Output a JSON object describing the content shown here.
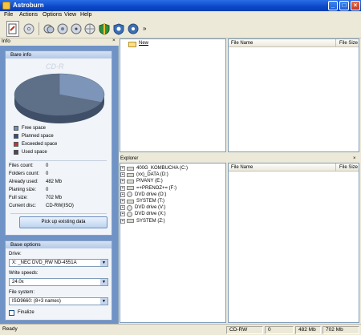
{
  "window": {
    "title": "Astroburn"
  },
  "menu": [
    "File",
    "Actions",
    "Options",
    "View",
    "Help"
  ],
  "toolbar": {
    "icons": [
      "new-project-icon",
      "burn-disc-icon",
      "copy-disc-icon",
      "erase-disc-icon",
      "disc-info-icon",
      "settings-icon",
      "shield-icon",
      "disc-image-icon",
      "help-icon"
    ],
    "expand_glyph": "»"
  },
  "info": {
    "header": "Info",
    "close_glyph": "×",
    "bare_info_title": "Bare info",
    "watermark": "CD-R",
    "legend": [
      {
        "label": "Free space",
        "color": "#6f8fb8"
      },
      {
        "label": "Planned space",
        "color": "#2f4f86"
      },
      {
        "label": "Exceeded space",
        "color": "#c0392b"
      },
      {
        "label": "Used space",
        "color": "#4a4a5a"
      }
    ],
    "stats": [
      {
        "label": "Files count:",
        "value": "0"
      },
      {
        "label": "Folders count:",
        "value": "0"
      },
      {
        "label": "Already used:",
        "value": "482 Mb"
      },
      {
        "label": "Planing size:",
        "value": "0"
      },
      {
        "label": "Full size:",
        "value": "702 Mb"
      },
      {
        "label": "Current disc:",
        "value": "CD-RW(ISO)"
      }
    ],
    "pick_button": "Pick up existing data"
  },
  "base_options": {
    "title": "Base options",
    "drive_label": "Drive:",
    "drive_value": "X: _NEC   DVD_RW ND-4551A",
    "write_speed_label": "Write speeds:",
    "write_speed_value": "24.0x",
    "file_system_label": "File system:",
    "file_system_value": "ISO9660: (8+3 names)",
    "finalize_label": "Finalize",
    "combo_arrow": "▼"
  },
  "project": {
    "tree_root": "New",
    "columns": [
      "File Name",
      "File Size"
    ]
  },
  "explorer": {
    "header": "Explorer",
    "close_glyph": "×",
    "columns": [
      "File Name",
      "File Size"
    ],
    "expand_glyph": "+",
    "drives": [
      {
        "label": "400G_KOMBUCHA (C:)",
        "kind": "hdd"
      },
      {
        "label": "(xx)_DATA (D:)",
        "kind": "hdd"
      },
      {
        "label": "PIVANY (E:)",
        "kind": "hdd"
      },
      {
        "label": "=+PRENOZ+= (F:)",
        "kind": "hdd"
      },
      {
        "label": "DVD drive (O:)",
        "kind": "cd"
      },
      {
        "label": "SYSTEM (T:)",
        "kind": "hdd"
      },
      {
        "label": "DVD drive (V:)",
        "kind": "cd"
      },
      {
        "label": "DVD drive (X:)",
        "kind": "cd"
      },
      {
        "label": "SYSTEM (Z:)",
        "kind": "hdd"
      }
    ]
  },
  "status": {
    "left": "Ready",
    "disc": "CD-RW",
    "count": "0",
    "used": "482 Mb",
    "total": "702 Mb"
  },
  "chart_data": {
    "type": "pie",
    "categories": [
      "Free space",
      "Planned space",
      "Exceeded space",
      "Used space"
    ],
    "values": [
      31,
      0,
      0,
      69
    ]
  }
}
